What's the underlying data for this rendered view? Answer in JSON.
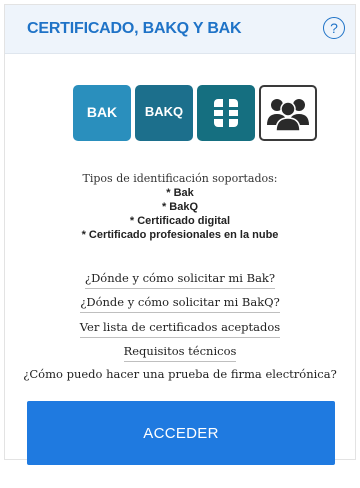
{
  "header": {
    "title": "CERTIFICADO, BAKQ Y BAK",
    "help_symbol": "?"
  },
  "logos": {
    "bak_label": "BAK",
    "bakq_label": "BAKQ",
    "cert_icon": "chip-card-icon",
    "cloud_icon": "group-of-people-icon"
  },
  "supported": {
    "intro": "Tipos de identificación soportados:",
    "items": [
      "* Bak",
      "* BakQ",
      "* Certificado digital",
      "* Certificado profesionales en la nube"
    ]
  },
  "links": [
    "¿Dónde y cómo solicitar mi Bak?",
    "¿Dónde y cómo solicitar mi BakQ?",
    "Ver lista de certificados aceptados",
    "Requisitos técnicos",
    "¿Cómo puedo hacer una prueba de firma electrónica?"
  ],
  "button": {
    "label": "ACCEDER"
  },
  "colors": {
    "accent": "#1f7ae0",
    "header_text": "#1f73c7",
    "header_bg": "#eef4fb"
  }
}
